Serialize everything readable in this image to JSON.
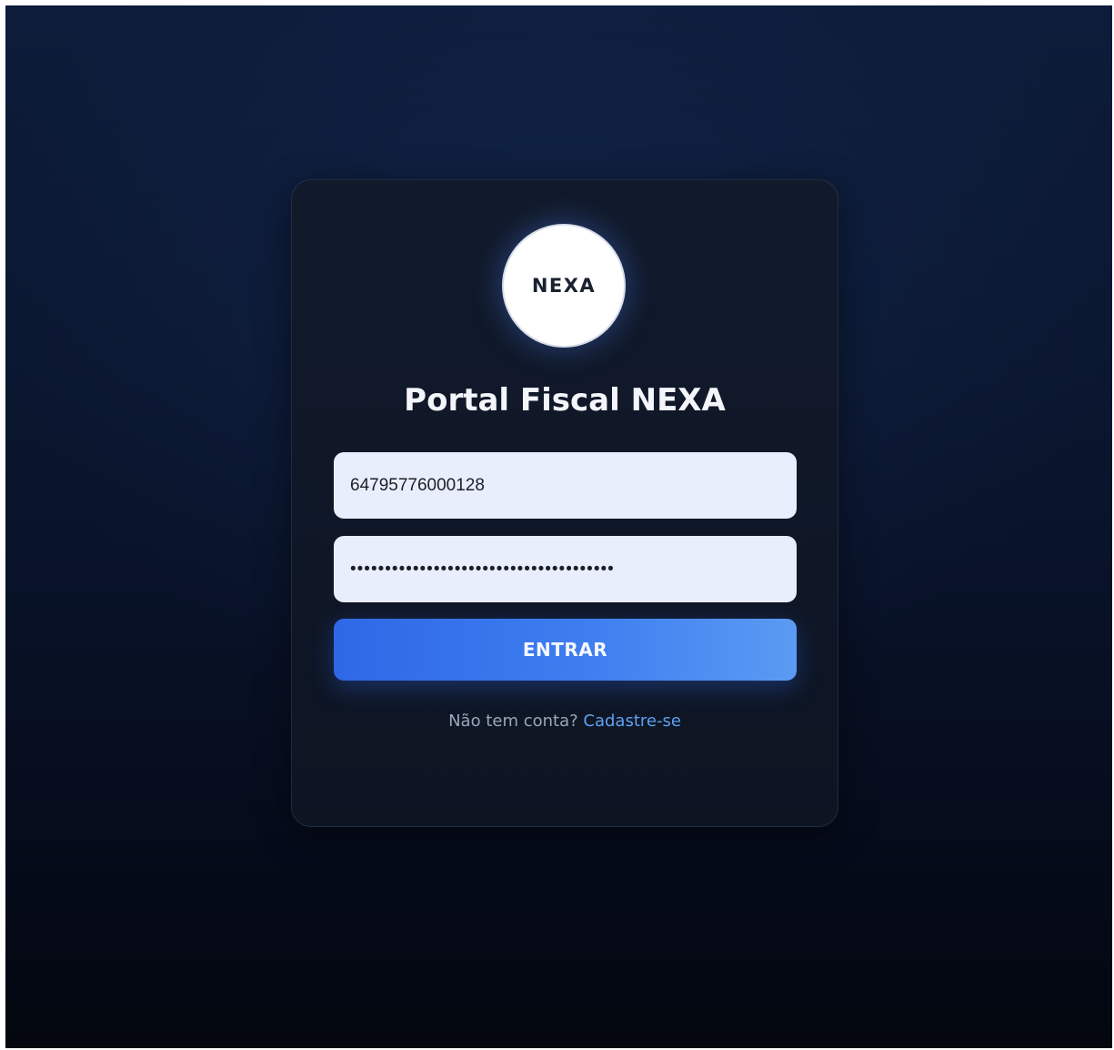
{
  "logo": {
    "text": "NEXA"
  },
  "login": {
    "title": "Portal Fiscal NEXA",
    "username_value": "64795776000128",
    "password_value": "••••••••••••••••••••••••••••••••••••••",
    "submit_label": "ENTRAR",
    "signup_prompt": "Não tem conta?",
    "signup_link": "Cadastre-se"
  },
  "colors": {
    "background": "#0b1730",
    "card": "#111a2b",
    "input": "#e8eefb",
    "button": "#3e7ef0",
    "link": "#5ea0f2"
  }
}
